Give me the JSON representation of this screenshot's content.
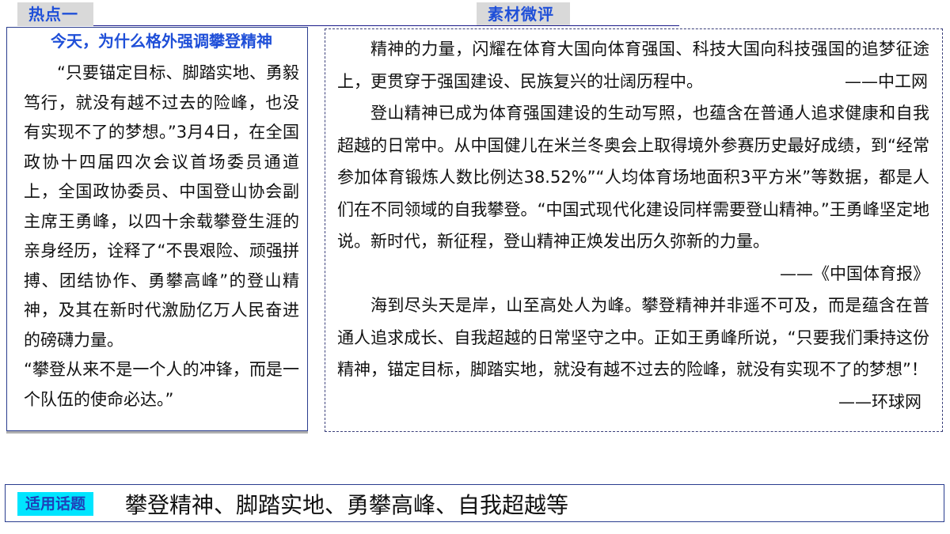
{
  "tags": {
    "hot_topic": "热点一",
    "material_review": "素材微评",
    "applicable_topics": "适用话题"
  },
  "left": {
    "title": "今天，为什么格外强调攀登精神",
    "paragraph_1": "“只要锚定目标、脚踏实地、勇毅笃行，就没有越不过去的险峰，也没有实现不了的梦想。”3月4日，在全国政协十四届四次会议首场委员通道上，全国政协委员、中国登山协会副主席王勇峰，以四十余载攀登生涯的亲身经历，诠释了“不畏艰险、顽强拼搏、团结协作、勇攀高峰”的登山精神，及其在新时代激励亿万人民奋进的磅礴力量。",
    "paragraph_2": "“攀登从来不是一个人的冲锋，而是一个队伍的使命必达。”"
  },
  "right": {
    "para_1": "精神的力量，闪耀在体育大国向体育强国、科技大国向科技强国的追梦征途上，更贯穿于强国建设、民族复兴的壮阔历程中。",
    "source_1": "——中工网",
    "para_2": "登山精神已成为体育强国建设的生动写照，也蕴含在普通人追求健康和自我超越的日常中。从中国健儿在米兰冬奥会上取得境外参赛历史最好成绩，到“经常参加体育锻炼人数比例达38.52%”“人均体育场地面积3平方米”等数据，都是人们在不同领域的自我攀登。“中国式现代化建设同样需要登山精神。”王勇峰坚定地说。新时代，新征程，登山精神正焕发出历久弥新的力量。",
    "source_2": "——《中国体育报》",
    "para_3": "海到尽头天是岸，山至高处人为峰。攀登精神并非遥不可及，而是蕴含在普通人追求成长、自我超越的日常坚守之中。正如王勇峰所说，“只要我们秉持这份精神，锚定目标，脚踏实地，就没有越不过去的险峰，就没有实现不了的梦想”！",
    "source_3": "——环球网"
  },
  "bottom": {
    "topics": "攀登精神、脚踏实地、勇攀高峰、自我超越等"
  },
  "colors": {
    "tag_text": "#1f4fd8",
    "tag_bg": "#d9d9d9",
    "bottom_tag_bg": "#00e5ff",
    "border": "#2a3d8f"
  }
}
